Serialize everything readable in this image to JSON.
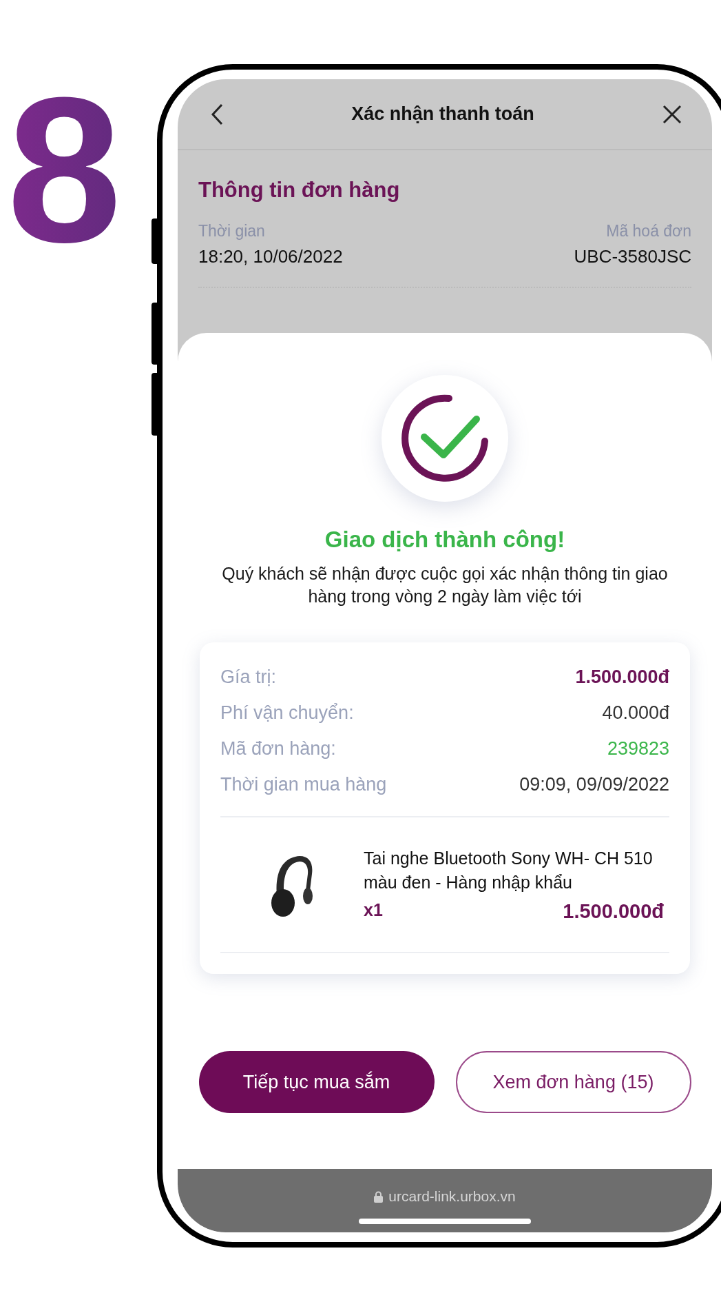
{
  "step_number": "8",
  "header": {
    "title": "Xác nhận thanh toán"
  },
  "order_info": {
    "title": "Thông tin đơn hàng",
    "time_label": "Thời gian",
    "time": "18:20, 10/06/2022",
    "invoice_label": "Mã hoá đơn",
    "invoice": "UBC-3580JSC"
  },
  "result": {
    "title": "Giao dịch thành công!",
    "message": "Quý khách sẽ nhận được cuộc gọi xác nhận thông tin giao hàng trong vòng 2 ngày làm việc tới"
  },
  "summary": [
    {
      "label": "Gía trị:",
      "value": "1.500.000đ",
      "kind": "price"
    },
    {
      "label": "Phí vận chuyển:",
      "value": "40.000đ",
      "kind": "plain"
    },
    {
      "label": "Mã đơn hàng:",
      "value": "239823",
      "kind": "code"
    },
    {
      "label": "Thời gian mua hàng",
      "value": "09:09, 09/09/2022",
      "kind": "plain"
    }
  ],
  "product": {
    "name": "Tai nghe Bluetooth Sony WH- CH 510 màu đen - Hàng nhập khẩu",
    "quantity": "x1",
    "price": "1.500.000đ"
  },
  "buttons": [
    {
      "label": "Tiếp tục mua sắm",
      "kind": "primary"
    },
    {
      "label": "Xem đơn hàng (15)",
      "kind": "secondary"
    }
  ],
  "browser_bar": {
    "url": "urcard-link.urbox.vn"
  }
}
